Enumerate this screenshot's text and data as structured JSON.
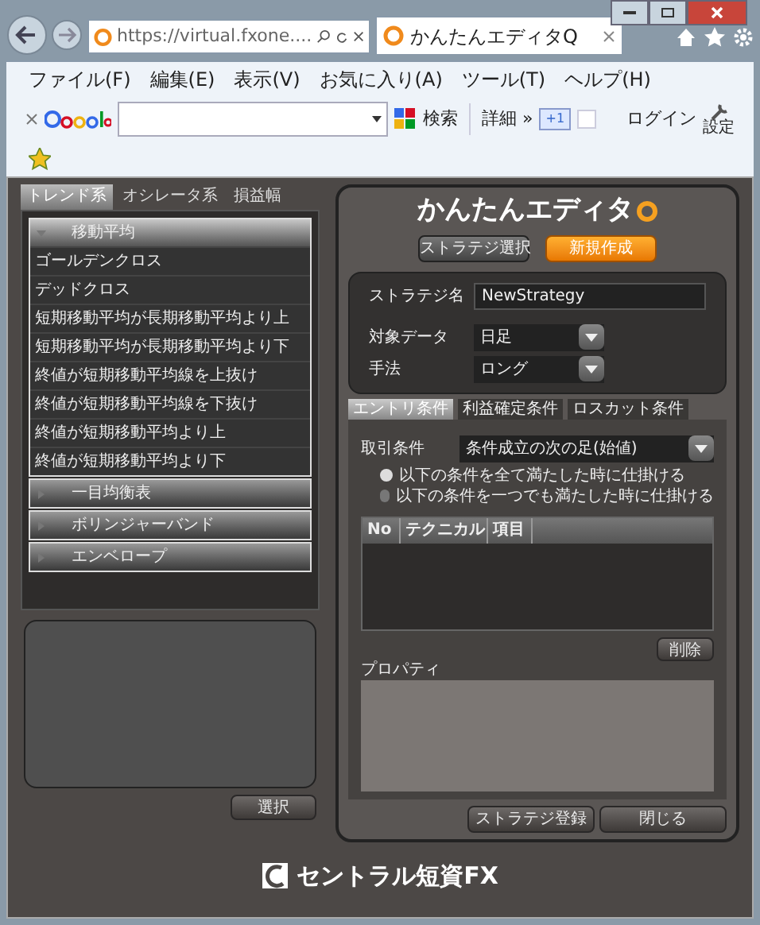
{
  "browser": {
    "address": "https://virtual.fxone....",
    "tabs": [
      {
        "title": "かんたんエディタQ",
        "selected": true
      }
    ],
    "menu": [
      "ファイル(F)",
      "編集(E)",
      "表示(V)",
      "お気に入り(A)",
      "ツール(T)",
      "ヘルプ(H)"
    ],
    "toolbar": {
      "search": "検索",
      "more": "詳細 »",
      "plus_one": "+1",
      "login": "ログイン",
      "settings": "設定"
    }
  },
  "left": {
    "tabs": [
      {
        "label": "トレンド系",
        "selected": true
      },
      {
        "label": "オシレータ系",
        "selected": false
      },
      {
        "label": "損益幅",
        "selected": false
      }
    ],
    "groups": [
      {
        "title": "移動平均",
        "expanded": true,
        "items": [
          "ゴールデンクロス",
          "デッドクロス",
          "短期移動平均が長期移動平均より上",
          "短期移動平均が長期移動平均より下",
          "終値が短期移動平均線を上抜け",
          "終値が短期移動平均線を下抜け",
          "終値が短期移動平均より上",
          "終値が短期移動平均より下"
        ]
      },
      {
        "title": "一目均衡表",
        "expanded": false
      },
      {
        "title": "ボリンジャーバンド",
        "expanded": false
      },
      {
        "title": "エンベロープ",
        "expanded": false
      }
    ],
    "select_button": "選択"
  },
  "editor": {
    "title": "かんたんエディタ",
    "modes": [
      {
        "label": "ストラテジ選択",
        "selected": false
      },
      {
        "label": "新規作成",
        "selected": true
      }
    ],
    "fields": [
      {
        "label": "ストラテジ名",
        "value": "NewStrategy",
        "kind": "text"
      },
      {
        "label": "対象データ",
        "value": "日足",
        "kind": "select"
      },
      {
        "label": "手法",
        "value": "ロング",
        "kind": "select"
      }
    ],
    "tabs": [
      {
        "label": "エントリ条件",
        "selected": true
      },
      {
        "label": "利益確定条件",
        "selected": false
      },
      {
        "label": "ロスカット条件",
        "selected": false
      }
    ],
    "trade_condition": {
      "label": "取引条件",
      "value": "条件成立の次の足(始値)"
    },
    "radios": [
      {
        "label": "以下の条件を全て満たした時に仕掛ける",
        "selected": true
      },
      {
        "label": "以下の条件を一つでも満たした時に仕掛ける",
        "selected": false
      }
    ],
    "table": {
      "columns": [
        "No",
        "テクニカル",
        "項目"
      ]
    },
    "delete_button": "削除",
    "property_label": "プロパティ",
    "footer_buttons": [
      "ストラテジ登録",
      "閉じる"
    ]
  },
  "logo": "セントラル短資FX"
}
